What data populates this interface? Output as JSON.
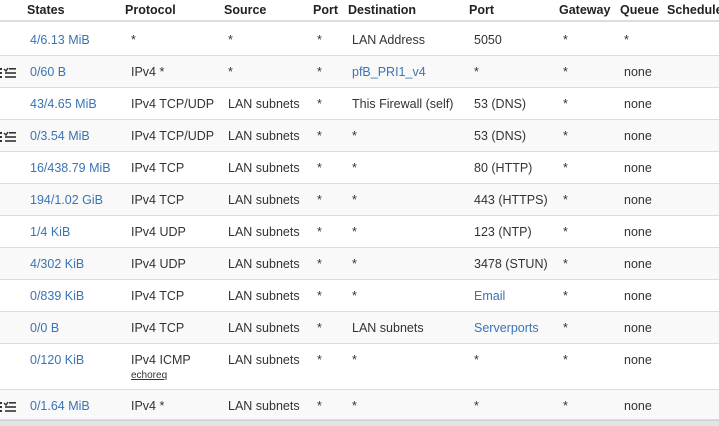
{
  "headers": {
    "states": "States",
    "protocol": "Protocol",
    "source": "Source",
    "port": "Port",
    "destination": "Destination",
    "dport": "Port",
    "gateway": "Gateway",
    "queue": "Queue",
    "schedule": "Schedule"
  },
  "rows": [
    {
      "states": "4/6.13 MiB",
      "protocol": "*",
      "source": "*",
      "sport": "*",
      "destination": "LAN Address",
      "dport": "5050",
      "gateway": "*",
      "queue": "*",
      "anchor": false
    },
    {
      "states": "0/60 B",
      "protocol": "IPv4 *",
      "source": "*",
      "sport": "*",
      "destination": "pfB_PRI1_v4",
      "dport": "*",
      "gateway": "*",
      "queue": "none",
      "anchor": true
    },
    {
      "states": "43/4.65 MiB",
      "protocol": "IPv4 TCP/UDP",
      "source": "LAN subnets",
      "sport": "*",
      "destination": "This Firewall (self)",
      "dport": "53 (DNS)",
      "gateway": "*",
      "queue": "none",
      "anchor": false
    },
    {
      "states": "0/3.54 MiB",
      "protocol": "IPv4 TCP/UDP",
      "source": "LAN subnets",
      "sport": "*",
      "destination": "*",
      "dport": "53 (DNS)",
      "gateway": "*",
      "queue": "none",
      "anchor": true
    },
    {
      "states": "16/438.79 MiB",
      "protocol": "IPv4 TCP",
      "source": "LAN subnets",
      "sport": "*",
      "destination": "*",
      "dport": "80 (HTTP)",
      "gateway": "*",
      "queue": "none",
      "anchor": false
    },
    {
      "states": "194/1.02 GiB",
      "protocol": "IPv4 TCP",
      "source": "LAN subnets",
      "sport": "*",
      "destination": "*",
      "dport": "443 (HTTPS)",
      "gateway": "*",
      "queue": "none",
      "anchor": false
    },
    {
      "states": "1/4 KiB",
      "protocol": "IPv4 UDP",
      "source": "LAN subnets",
      "sport": "*",
      "destination": "*",
      "dport": "123 (NTP)",
      "gateway": "*",
      "queue": "none",
      "anchor": false
    },
    {
      "states": "4/302 KiB",
      "protocol": "IPv4 UDP",
      "source": "LAN subnets",
      "sport": "*",
      "destination": "*",
      "dport": "3478 (STUN)",
      "gateway": "*",
      "queue": "none",
      "anchor": false
    },
    {
      "states": "0/839 KiB",
      "protocol": "IPv4 TCP",
      "source": "LAN subnets",
      "sport": "*",
      "destination": "*",
      "dport": "Email",
      "gateway": "*",
      "queue": "none",
      "anchor": false
    },
    {
      "states": "0/0 B",
      "protocol": "IPv4 TCP",
      "source": "LAN subnets",
      "sport": "*",
      "destination": "LAN subnets",
      "dport": "Serverports",
      "gateway": "*",
      "queue": "none",
      "anchor": false
    },
    {
      "states": "0/120 KiB",
      "protocol": "IPv4 ICMP",
      "protocol_sub": "echoreq",
      "source": "LAN subnets",
      "sport": "*",
      "destination": "*",
      "dport": "*",
      "gateway": "*",
      "queue": "none",
      "anchor": false
    },
    {
      "states": "0/1.64 MiB",
      "protocol": "IPv4 *",
      "source": "LAN subnets",
      "sport": "*",
      "destination": "*",
      "dport": "*",
      "gateway": "*",
      "queue": "none",
      "anchor": true
    }
  ],
  "link_values": [
    "pfB_PRI1_v4",
    "Email",
    "Serverports"
  ],
  "colors": {
    "link": "#3a74b4",
    "text": "#333333",
    "border": "#dddddd",
    "row_alt": "#f9f9f9"
  },
  "icons": {
    "anchor": "anchor-list-icon"
  }
}
